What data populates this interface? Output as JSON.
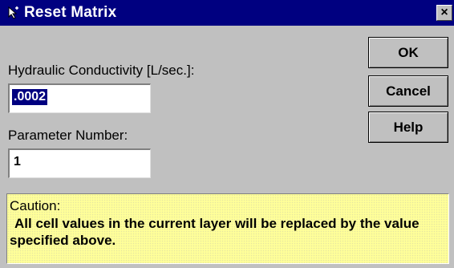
{
  "window": {
    "title": "Reset Matrix",
    "close_glyph": "×",
    "icon": "arrow-cursor-icon"
  },
  "form": {
    "conductivity_label": "Hydraulic Conductivity [L/sec.]:",
    "conductivity_value": ".0002",
    "parameter_label": "Parameter Number:",
    "parameter_value": "1"
  },
  "buttons": {
    "ok": "OK",
    "cancel": "Cancel",
    "help": "Help"
  },
  "caution": {
    "title": "Caution:",
    "text": "All cell values in the current layer will be replaced by the value specified above."
  },
  "colors": {
    "titlebar": "#000080",
    "dialog": "#c0c0c0",
    "caution_bg": "#ffff99",
    "selection": "#000080"
  }
}
